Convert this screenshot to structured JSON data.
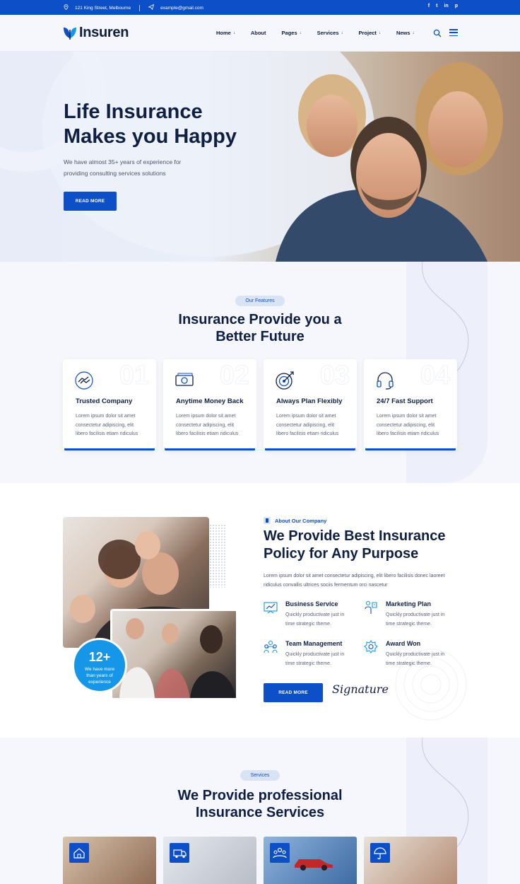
{
  "topbar": {
    "address": "121 King Street, Melbourne",
    "email": "example@gmail.com",
    "social": [
      "f",
      "t",
      "in",
      "p"
    ]
  },
  "nav": {
    "brand": "Insuren",
    "menu": [
      "Home",
      "About",
      "Pages",
      "Services",
      "Project",
      "News"
    ],
    "menu_has_dropdown": [
      true,
      false,
      true,
      true,
      true,
      true
    ]
  },
  "hero": {
    "title_line1": "Life Insurance",
    "title_line2": "Makes you Happy",
    "subtitle_line1": "We have almost 35+ years of experience for",
    "subtitle_line2": "providing consulting services solutions",
    "button": "READ MORE"
  },
  "features": {
    "tag": "Our Features",
    "title_line1": "Insurance Provide you a",
    "title_line2": "Better Future",
    "cards": [
      {
        "num": "01",
        "title": "Trusted Company",
        "icon": "handshake-icon",
        "text": [
          "Lorem ipsum dolor sit amet",
          "consectetur adipiscing, elit",
          "libero facilisis etiam ridiculus"
        ]
      },
      {
        "num": "02",
        "title": "Anytime Money Back",
        "icon": "money-icon",
        "text": [
          "Lorem ipsum dolor sit amet",
          "consectetur adipiscing, elit",
          "libero facilisis etiam ridiculus"
        ]
      },
      {
        "num": "03",
        "title": "Always Plan Flexibly",
        "icon": "target-icon",
        "text": [
          "Lorem ipsum dolor sit amet",
          "consectetur adipiscing, elit",
          "libero facilisis etiam ridiculus"
        ]
      },
      {
        "num": "04",
        "title": "24/7 Fast Support",
        "icon": "headset-icon",
        "text": [
          "Lorem ipsum dolor sit amet",
          "consectetur adipiscing, elit",
          "libero facilisis etiam ridiculus"
        ]
      }
    ]
  },
  "about": {
    "tag": "About Our Company",
    "title_line1": "We Provide Best Insurance",
    "title_line2": "Policy for Any Purpose",
    "text_line1": "Lorem ipsum dolor sit amet consectetur adipiscing, elit libero facilisis donec laoreet",
    "text_line2": "ridiculus convallis ultrices sociis fermentum orci nascetur",
    "badge_number": "12+",
    "badge_line1": "We have more",
    "badge_line2": "than years of",
    "badge_line3": "experience",
    "items": [
      {
        "title": "Business Service",
        "icon": "presentation-icon",
        "text": [
          "Quickly productivate just in",
          "time strategic theme."
        ]
      },
      {
        "title": "Marketing Plan",
        "icon": "strategy-icon",
        "text": [
          "Quickly productivate just in",
          "time strategic theme."
        ]
      },
      {
        "title": "Team Management",
        "icon": "team-icon",
        "text": [
          "Quickly productivate just in",
          "time strategic theme."
        ]
      },
      {
        "title": "Award Won",
        "icon": "award-icon",
        "text": [
          "Quickly productivate just in",
          "time strategic theme."
        ]
      }
    ],
    "button": "READ MORE",
    "signature": "Signature"
  },
  "services": {
    "tag": "Services",
    "title_line1": "We Provide professional",
    "title_line2": "Insurance Services"
  },
  "colors": {
    "primary": "#0d4fc6",
    "dark": "#0f1e43",
    "accent": "#1596e8"
  }
}
